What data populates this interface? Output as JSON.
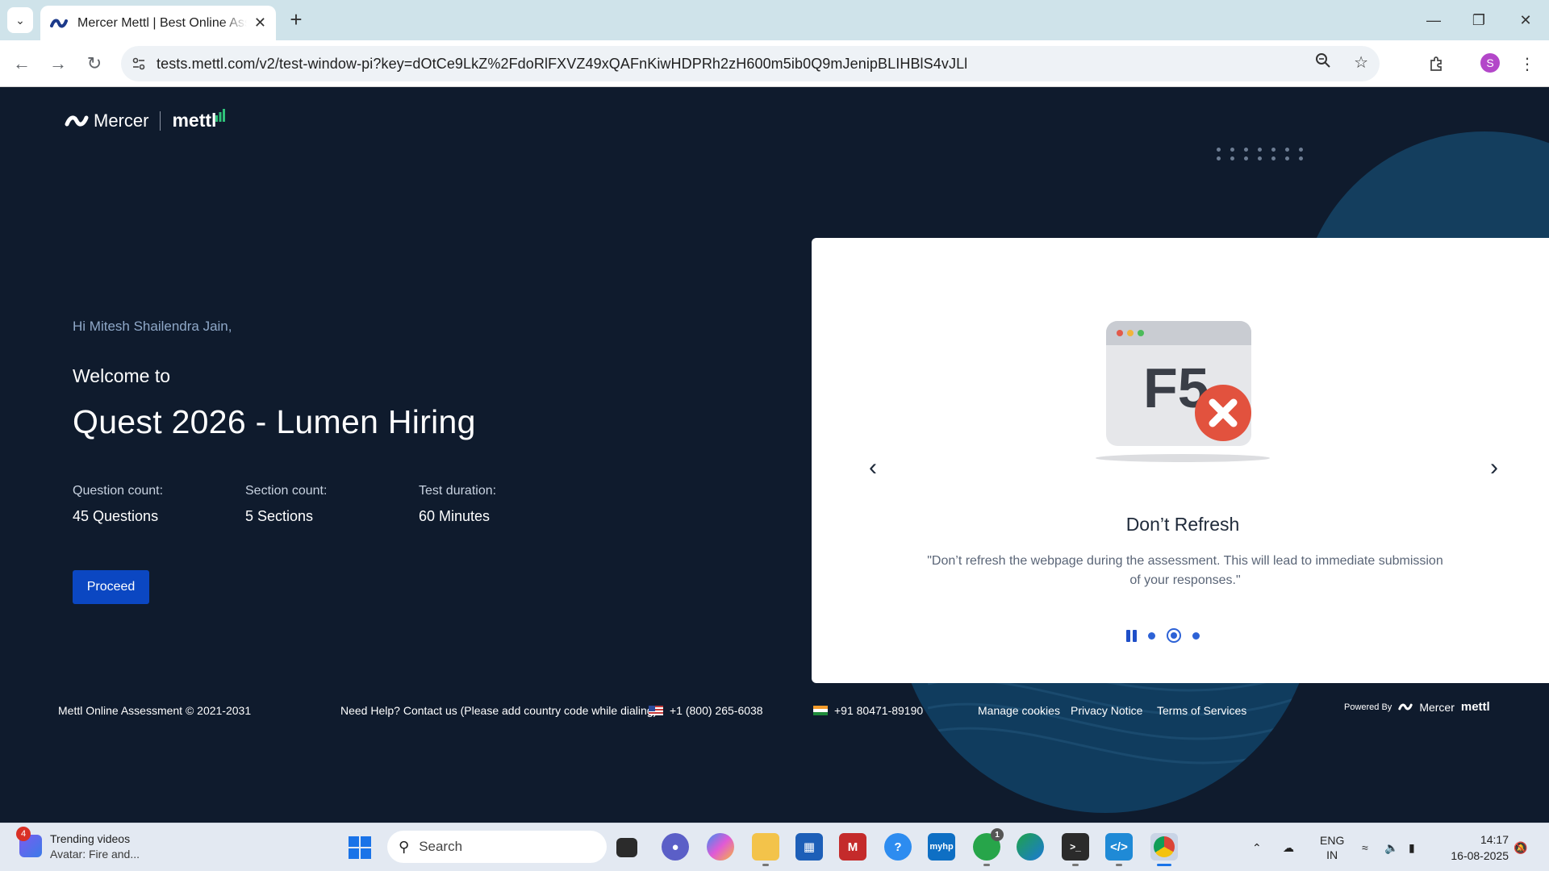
{
  "browser": {
    "tab_title": "Mercer Mettl | Best Online Assessment",
    "url": "tests.mettl.com/v2/test-window-pi?key=dOtCe9LkZ%2FdoRlFXVZ49xQAFnKiwHDPRh2zH600m5ib0Q9mJenipBLIHBlS4vJLl",
    "profile_initial": "S"
  },
  "page": {
    "logo_mercer": "Mercer",
    "logo_mettl": "mettl",
    "greeting": "Hi Mitesh Shailendra Jain,",
    "welcome": "Welcome to",
    "test_name": "Quest 2026 - Lumen Hiring",
    "stats": [
      {
        "label": "Question count:",
        "value": "45 Questions"
      },
      {
        "label": "Section count:",
        "value": "5 Sections"
      },
      {
        "label": "Test duration:",
        "value": "60 Minutes"
      }
    ],
    "proceed_label": "Proceed"
  },
  "carousel": {
    "key_label": "F5",
    "title": "Don’t Refresh",
    "description": "\"Don’t refresh the webpage during the assessment. This will lead to immediate submission of your responses.\"",
    "slide_count": 3,
    "active_slide": 2
  },
  "footer": {
    "copyright": "Mettl Online Assessment © 2021-2031",
    "help": "Need Help? Contact us (Please add country code while dialing)",
    "phone_us": "+1 (800) 265-6038",
    "phone_in": "+91 80471-89190",
    "manage_cookies": "Manage cookies",
    "privacy": "Privacy Notice",
    "terms": "Terms of Services",
    "powered_by": "Powered By",
    "powered_mercer": "Mercer",
    "powered_mettl": "mettl"
  },
  "taskbar": {
    "news_badge": "4",
    "news_title": "Trending videos",
    "news_sub": "Avatar: Fire and...",
    "search_placeholder": "Search",
    "whatsapp_badge": "1",
    "lang_line1": "ENG",
    "lang_line2": "IN",
    "time": "14:17",
    "date": "16-08-2025"
  },
  "colors": {
    "page_bg": "#0f1b2d",
    "accent": "#0b47c2",
    "error_red": "#e2523e"
  }
}
